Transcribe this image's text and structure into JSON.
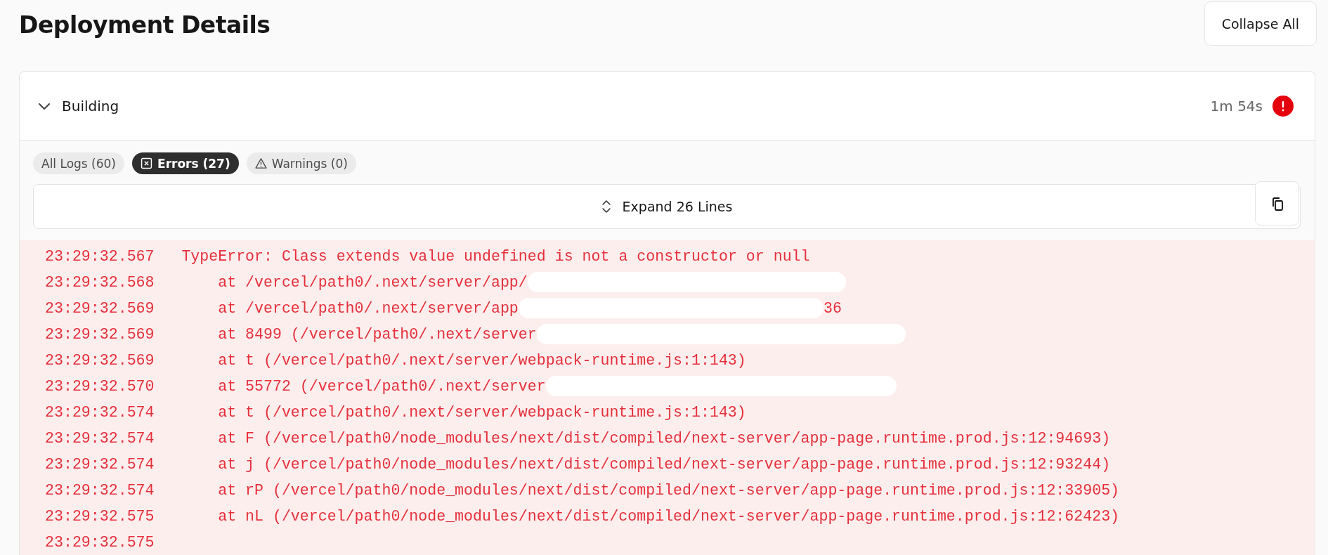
{
  "page": {
    "title": "Deployment Details",
    "collapse_button": "Collapse All"
  },
  "section": {
    "title": "Building",
    "expanded": true,
    "duration": "1m 54s",
    "failed": true
  },
  "filters": [
    {
      "label": "All Logs (60)",
      "kind": "all",
      "selected": false
    },
    {
      "label": "Errors (27)",
      "kind": "error",
      "selected": true
    },
    {
      "label": "Warnings (0)",
      "kind": "warning",
      "selected": false
    }
  ],
  "expand_button": "Expand 26 Lines",
  "log_lines": [
    {
      "time": "23:29:32.567",
      "kind": "message",
      "text": "TypeError: Class extends value undefined is not a constructor or null",
      "redacted": false
    },
    {
      "time": "23:29:32.568",
      "kind": "frame",
      "text": "at /vercel/path0/.next/server/app/",
      "redacted": true
    },
    {
      "time": "23:29:32.569",
      "kind": "frame",
      "text": "at /vercel/path0/.next/server/app",
      "redacted": true,
      "suffix": "36"
    },
    {
      "time": "23:29:32.569",
      "kind": "frame",
      "text": "at 8499 (/vercel/path0/.next/server",
      "redacted": true
    },
    {
      "time": "23:29:32.569",
      "kind": "frame",
      "text": "at t (/vercel/path0/.next/server/webpack-runtime.js:1:143)",
      "redacted": false
    },
    {
      "time": "23:29:32.570",
      "kind": "frame",
      "text": "at 55772 (/vercel/path0/.next/server",
      "redacted": true
    },
    {
      "time": "23:29:32.574",
      "kind": "frame",
      "text": "at t (/vercel/path0/.next/server/webpack-runtime.js:1:143)",
      "redacted": false
    },
    {
      "time": "23:29:32.574",
      "kind": "frame",
      "text": "at F (/vercel/path0/node_modules/next/dist/compiled/next-server/app-page.runtime.prod.js:12:94693)",
      "redacted": false
    },
    {
      "time": "23:29:32.574",
      "kind": "frame",
      "text": "at j (/vercel/path0/node_modules/next/dist/compiled/next-server/app-page.runtime.prod.js:12:93244)",
      "redacted": false
    },
    {
      "time": "23:29:32.574",
      "kind": "frame",
      "text": "at rP (/vercel/path0/node_modules/next/dist/compiled/next-server/app-page.runtime.prod.js:12:33905)",
      "redacted": false
    },
    {
      "time": "23:29:32.575",
      "kind": "frame",
      "text": "at nL (/vercel/path0/node_modules/next/dist/compiled/next-server/app-page.runtime.prod.js:12:62423)",
      "redacted": false
    },
    {
      "time": "23:29:32.575"
    }
  ]
}
